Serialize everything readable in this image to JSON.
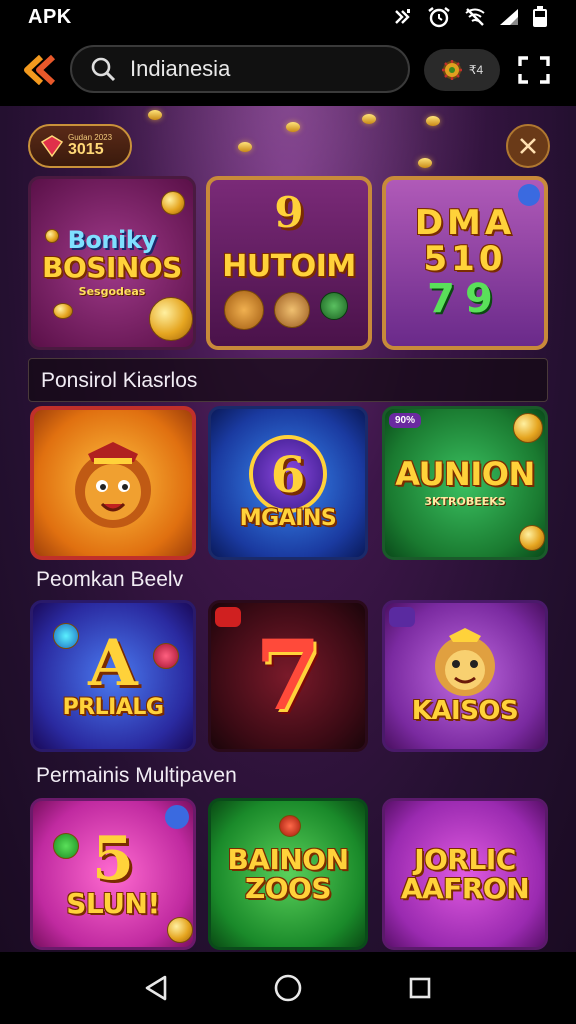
{
  "status_bar": {
    "app_label": "APK",
    "icons": [
      "vibrate-icon",
      "alarm-icon",
      "wifi-off-icon",
      "signal-icon",
      "battery-icon"
    ]
  },
  "app_bar": {
    "back_icon": "double-chevron-left-icon",
    "search": {
      "value": "Indianesia",
      "placeholder": "",
      "icon": "search-icon"
    },
    "coin_pill": {
      "icon": "gear-coin-icon",
      "label": "₹4"
    },
    "fullscreen_icon": "fullscreen-icon"
  },
  "promo": {
    "badge_small": "Gudan 2023",
    "badge_big": "3015",
    "close_icon": "close-icon"
  },
  "colors": {
    "accent": "#f5a623",
    "background_top": "#6a2a78",
    "background_bottom": "#1a0b22",
    "gold_text": "#ffd23a"
  },
  "featured": [
    {
      "title": "Boniky",
      "subtitle": "BOSINOS",
      "caption": "Sesgodeas"
    },
    {
      "title": "HUTOIM",
      "number": "9"
    },
    {
      "title": "DMA",
      "number": "510",
      "extra": "79"
    }
  ],
  "sections": [
    {
      "title": "Ponsirol Kiasrlos",
      "games": [
        {
          "title": "",
          "kind": "lion"
        },
        {
          "title": "MGAINS",
          "number": "6"
        },
        {
          "title": "AUNION",
          "subtitle": "3KTROBEEKS",
          "tag": "90%"
        }
      ]
    },
    {
      "title": "Peomkan Beelv",
      "games": [
        {
          "title": "PRLIALG",
          "number": "A"
        },
        {
          "title": "",
          "number": "7"
        },
        {
          "title": "KAISOS",
          "kind": "lion"
        }
      ]
    },
    {
      "title": "Permainis Multipaven",
      "games": [
        {
          "title": "SLUN!",
          "number": "5"
        },
        {
          "title": "BAINON",
          "subtitle": "ZOOS"
        },
        {
          "title": "JORLIC",
          "subtitle": "AAFRON"
        }
      ]
    }
  ],
  "nav_bar": {
    "icons": [
      "back-triangle-icon",
      "home-circle-icon",
      "recents-square-icon"
    ]
  }
}
